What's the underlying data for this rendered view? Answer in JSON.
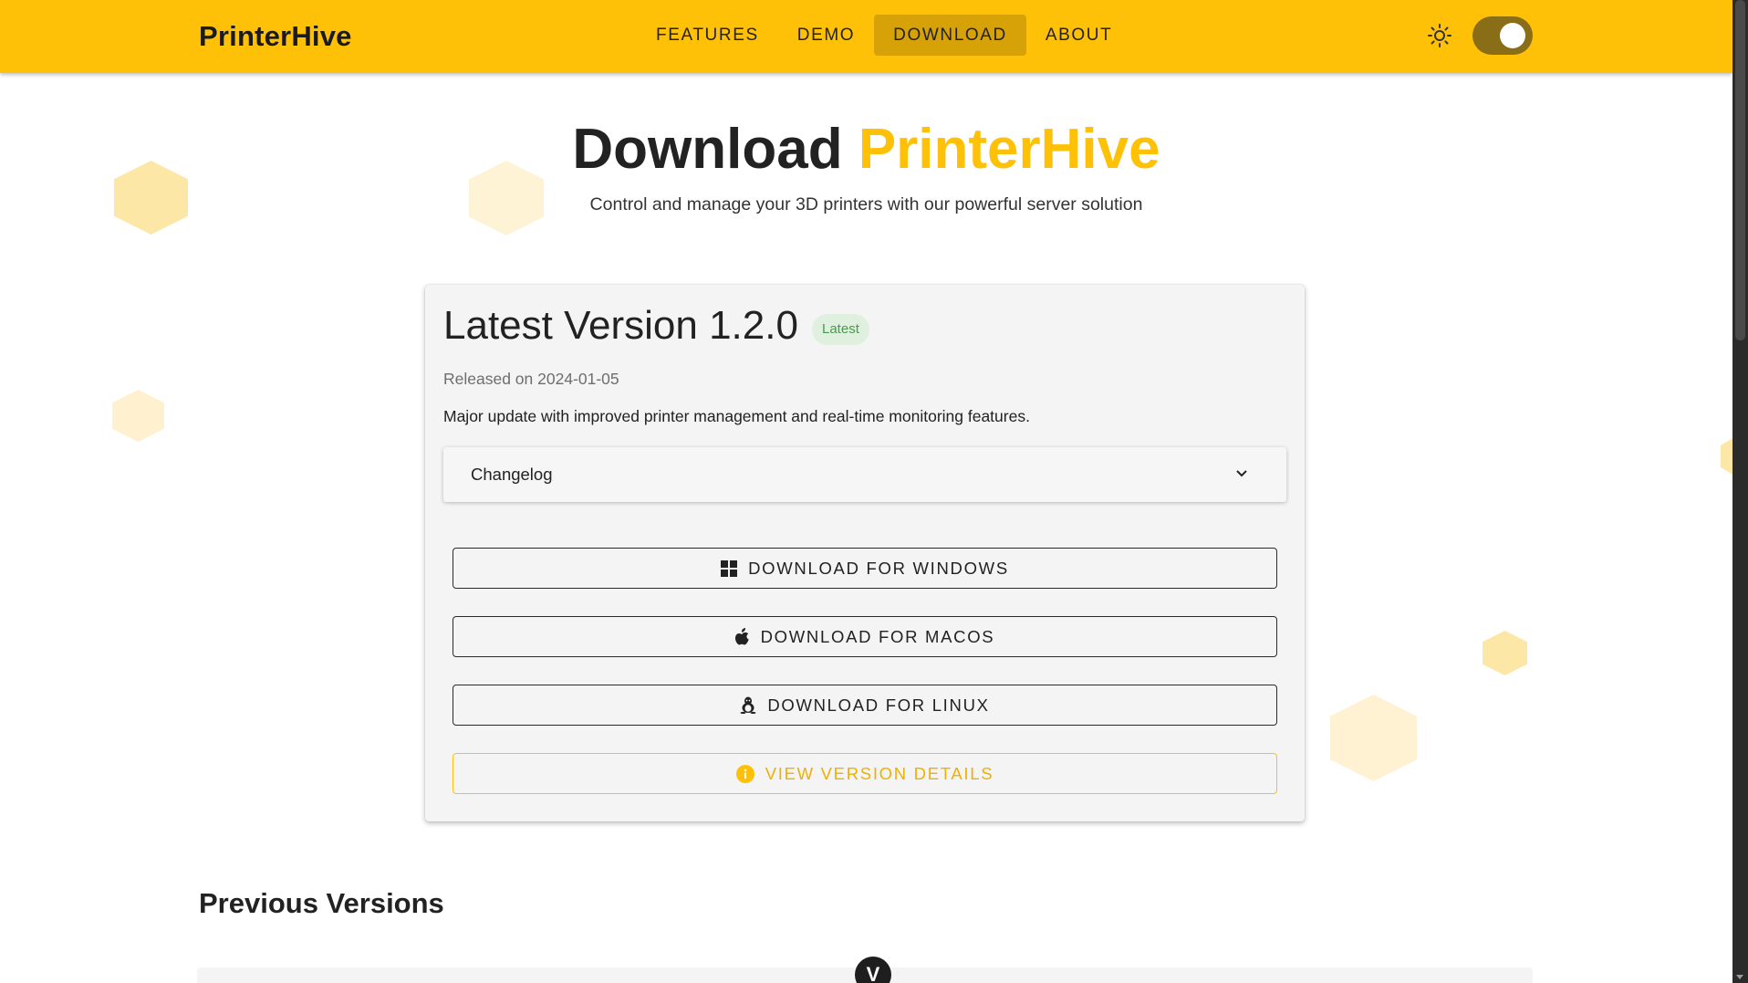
{
  "header": {
    "brand": "PrinterHive",
    "nav": [
      {
        "label": "FEATURES"
      },
      {
        "label": "DEMO"
      },
      {
        "label": "DOWNLOAD"
      },
      {
        "label": "ABOUT"
      }
    ],
    "active_nav": "DOWNLOAD",
    "theme_icon": "sun-icon",
    "theme_toggle_on": true
  },
  "hero": {
    "title_prefix": "Download",
    "title_accent": "PrinterHive",
    "subtitle": "Control and manage your 3D printers with our powerful server solution"
  },
  "latest": {
    "title": "Latest Version 1.2.0",
    "badge": "Latest",
    "released": "Released on 2024-01-05",
    "description": "Major update with improved printer management and real-time monitoring features.",
    "changelog_label": "Changelog",
    "buttons": {
      "windows": "DOWNLOAD FOR WINDOWS",
      "macos": "DOWNLOAD FOR MACOS",
      "linux": "DOWNLOAD FOR LINUX",
      "details": "VIEW VERSION DETAILS"
    }
  },
  "previous": {
    "title": "Previous Versions"
  },
  "fab": {
    "label": "V"
  },
  "colors": {
    "accent": "#ffc107",
    "badge_bg": "#dff0df",
    "badge_text": "#4a9a4d",
    "toggle_track": "#8a6d17"
  }
}
